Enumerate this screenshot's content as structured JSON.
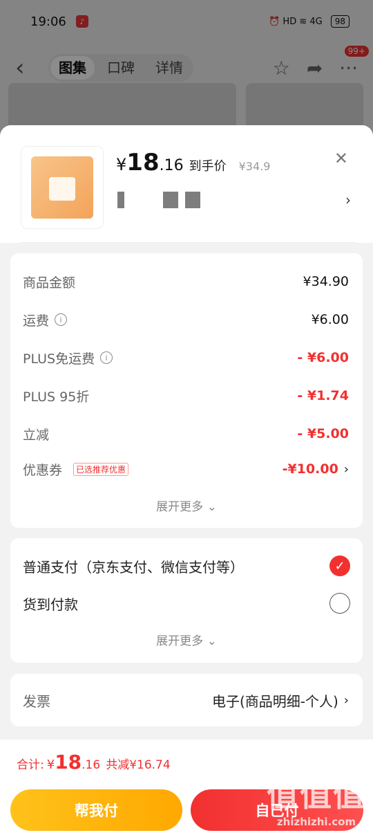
{
  "status": {
    "time": "19:06",
    "app_icon": "♪",
    "battery": "98",
    "icons": "⏰ HD ≋ 4G"
  },
  "nav": {
    "tabs": [
      {
        "label": "图集",
        "active": true
      },
      {
        "label": "口碑",
        "active": false
      },
      {
        "label": "详情",
        "active": false
      }
    ],
    "badge": "99+"
  },
  "product": {
    "price_symbol": "¥",
    "price_int": "18",
    "price_dec": ".16",
    "price_label": "到手价",
    "original_price": "¥34.9"
  },
  "costs": {
    "rows": [
      {
        "label": "商品金额",
        "value": "¥34.90",
        "red": false,
        "info": false
      },
      {
        "label": "运费",
        "value": "¥6.00",
        "red": false,
        "info": true
      },
      {
        "label": "PLUS免运费",
        "value": "- ¥6.00",
        "red": true,
        "info": true
      },
      {
        "label": "PLUS 95折",
        "value": "- ¥1.74",
        "red": true,
        "info": false
      },
      {
        "label": "立减",
        "value": "- ¥5.00",
        "red": true,
        "info": false
      }
    ],
    "coupon": {
      "label": "优惠券",
      "tag": "已选推荐优惠",
      "value": "-¥10.00"
    },
    "expand_label": "展开更多 ⌄"
  },
  "payment": {
    "options": [
      {
        "label": "普通支付（京东支付、微信支付等）",
        "selected": true
      },
      {
        "label": "货到付款",
        "selected": false
      }
    ],
    "expand_label": "展开更多 ⌄"
  },
  "invoice": {
    "label": "发票",
    "value": "电子(商品明细-个人)"
  },
  "footer": {
    "total_label": "合计:",
    "total_symbol": "¥",
    "total_int": "18",
    "total_dec": ".16",
    "total_saved": "共减¥16.74",
    "help_pay_label": "帮我付",
    "self_pay_label": "自己付"
  },
  "watermark": {
    "glyph": "值值值",
    "text": "zhizhizhi.com"
  },
  "colors": {
    "accent_red": "#f23030",
    "accent_yellow": "#ffb400"
  }
}
